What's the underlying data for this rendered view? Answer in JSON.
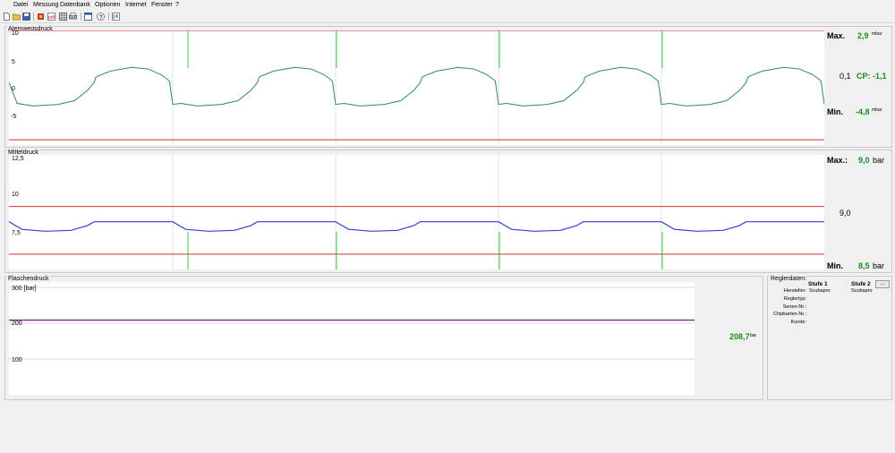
{
  "menubar": {
    "items": [
      "Datei",
      "Messung",
      "Datenbank",
      "Optionen",
      "Internet",
      "Fenster",
      "?"
    ]
  },
  "toolbar": {
    "icons": [
      "new-file-icon",
      "open-folder-icon",
      "save-icon",
      "record-icon",
      "pdf-icon",
      "grid-icon",
      "print-icon",
      "window-icon",
      "help-icon",
      "info-icon"
    ]
  },
  "panels": {
    "atmung": {
      "title": "Atemwegsdruck",
      "yticks": [
        "10",
        "5",
        "0",
        "-5"
      ],
      "max_label": "Max.",
      "max_value": "2,9",
      "max_unit": "mbar",
      "current_value": "0,1",
      "cp_label": "CP: -1,1",
      "min_label": "Min.",
      "min_value": "-4,8",
      "min_unit": "mbar"
    },
    "mittel": {
      "title": "Mitteldruck",
      "yticks": [
        "12,5",
        "10",
        "7,5"
      ],
      "max_label": "Max.:",
      "max_value": "9,0",
      "max_unit": "bar",
      "current_value": "9,0",
      "min_label": "Min.",
      "min_value": "8,5",
      "min_unit": "bar"
    },
    "flasche": {
      "title": "Flaschendruck",
      "yticks": [
        "300 [bar]",
        "200",
        "100"
      ],
      "current_value": "208,7",
      "unit": "bar"
    },
    "regler": {
      "title": "Reglerdaten:",
      "more_button": "...",
      "col1_head": "Stufe 1",
      "col2_head": "Stufe 2",
      "rows": [
        {
          "label": "Hersteller:",
          "v1": "Scubapro",
          "v2": "Scubapro"
        },
        {
          "label": "Reglertyp:",
          "v1": "",
          "v2": ""
        },
        {
          "label": "Serien-Nr.:",
          "v1": "",
          "v2": ""
        },
        {
          "label": "Chipkarten-Nr.:",
          "v1": "",
          "v2": ""
        },
        {
          "label": "Kunde:",
          "v1": "",
          "v2": ""
        }
      ]
    }
  },
  "colors": {
    "atmung_trace": "#2e8b5e",
    "mittel_trace": "#3b3bd0",
    "limit_line": "#d03030",
    "marker": "#2ecc40",
    "flasche_trace": "#7a2a8a",
    "value_green": "#1a8a1a"
  },
  "chart_data": [
    {
      "type": "line",
      "title": "Atemwegsdruck",
      "ylim": [
        -12,
        10
      ],
      "yticks": [
        10,
        5,
        0,
        -5
      ],
      "limits": [
        10,
        -11
      ],
      "cycles": 5,
      "cycle_shape_y": [
        0,
        -4,
        -4.5,
        -4.2,
        -3.5,
        -1.5,
        0,
        1,
        1.2,
        2.2,
        2.9,
        2.6,
        1.5,
        0.3,
        -4.2
      ],
      "series": [
        {
          "values_summary": {
            "max": 2.9,
            "min": -4.8,
            "current": 0.1
          }
        }
      ]
    },
    {
      "type": "line",
      "title": "Mitteldruck",
      "ylim": [
        6.5,
        12.5
      ],
      "yticks": [
        12.5,
        10,
        7.5
      ],
      "limits": [
        9.8,
        7.3
      ],
      "cycles": 5,
      "cycle_shape_y": [
        9.0,
        8.6,
        8.5,
        8.55,
        8.8,
        9.0,
        9.0
      ],
      "series": [
        {
          "values_summary": {
            "max": 9.0,
            "min": 8.5,
            "current": 9.0
          }
        }
      ]
    },
    {
      "type": "line",
      "title": "Flaschendruck",
      "ylim": [
        0,
        300
      ],
      "yticks": [
        300,
        200,
        100
      ],
      "series": [
        {
          "values_summary": {
            "current": 208.7
          }
        }
      ]
    }
  ]
}
